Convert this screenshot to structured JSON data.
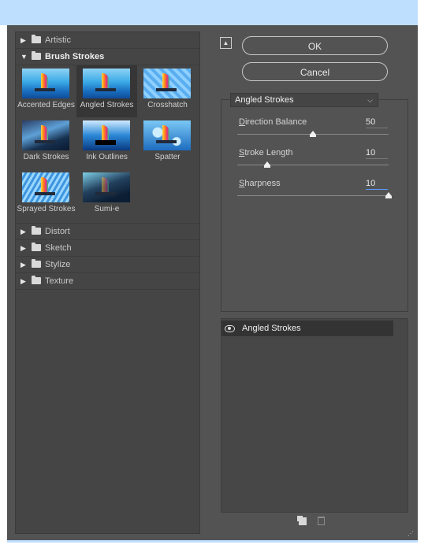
{
  "gallery": {
    "categories": [
      {
        "label": "Artistic",
        "expanded": false
      },
      {
        "label": "Brush Strokes",
        "expanded": true
      },
      {
        "label": "Distort",
        "expanded": false
      },
      {
        "label": "Sketch",
        "expanded": false
      },
      {
        "label": "Stylize",
        "expanded": false
      },
      {
        "label": "Texture",
        "expanded": false
      }
    ],
    "brush_strokes_filters": [
      "Accented Edges",
      "Angled Strokes",
      "Crosshatch",
      "Dark Strokes",
      "Ink Outlines",
      "Spatter",
      "Sprayed Strokes",
      "Sumi-e"
    ],
    "selected_filter": "Angled Strokes"
  },
  "buttons": {
    "ok": "OK",
    "cancel": "Cancel"
  },
  "filter_select": {
    "value": "Angled Strokes"
  },
  "params": [
    {
      "label": "Direction Balance",
      "accesskey": "D",
      "rest": "irection Balance",
      "value": "50",
      "fraction": 0.5
    },
    {
      "label": "Stroke Length",
      "accesskey": "S",
      "rest": "troke Length",
      "value": "10",
      "fraction": 0.2
    },
    {
      "label": "Sharpness",
      "accesskey": "S",
      "rest": "harpness",
      "value": "10",
      "fraction": 1.0
    }
  ],
  "layers": [
    {
      "name": "Angled Strokes",
      "visible": true
    }
  ],
  "icons": [
    "collapse-icon",
    "folder-icon",
    "eye-icon",
    "new-layer-icon",
    "trash-icon",
    "resize-grip-icon"
  ],
  "colors": {
    "panel_bg": "#535353",
    "gallery_bg": "#454545",
    "titlebar": "#bfdfff",
    "active_underline": "#5b9bff"
  }
}
